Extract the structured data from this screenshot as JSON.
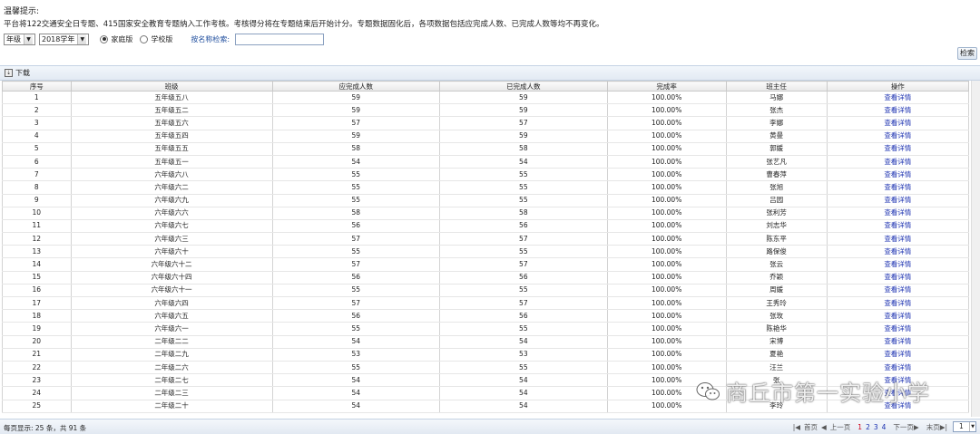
{
  "notice": {
    "title": "温馨提示:",
    "text": "平台将122交通安全日专题、415国家安全教育专题纳入工作考核。考核得分将在专题结束后开始计分。专题数据固化后，各项数据包括应完成人数、已完成人数等均不再变化。"
  },
  "filters": {
    "grade": "年级",
    "year": "2018学年",
    "radio_home": "家庭版",
    "radio_school": "学校版",
    "search_label": "按名称检索:",
    "search_value": "",
    "search_button": "检索"
  },
  "toolbar": {
    "download": "下载"
  },
  "table": {
    "headers": [
      "序号",
      "班级",
      "应完成人数",
      "已完成人数",
      "完成率",
      "班主任",
      "操作"
    ],
    "rows": [
      [
        "1",
        "五年级五八",
        "59",
        "59",
        "100.00%",
        "马娜",
        "查看详情"
      ],
      [
        "2",
        "五年级五二",
        "59",
        "59",
        "100.00%",
        "张杰",
        "查看详情"
      ],
      [
        "3",
        "五年级五六",
        "57",
        "57",
        "100.00%",
        "李娜",
        "查看详情"
      ],
      [
        "4",
        "五年级五四",
        "59",
        "59",
        "100.00%",
        "黄曼",
        "查看详情"
      ],
      [
        "5",
        "五年级五五",
        "58",
        "58",
        "100.00%",
        "郭媛",
        "查看详情"
      ],
      [
        "6",
        "五年级五一",
        "54",
        "54",
        "100.00%",
        "张艺凡",
        "查看详情"
      ],
      [
        "7",
        "六年级六八",
        "55",
        "55",
        "100.00%",
        "曹春萍",
        "查看详情"
      ],
      [
        "8",
        "六年级六二",
        "55",
        "55",
        "100.00%",
        "张旭",
        "查看详情"
      ],
      [
        "9",
        "六年级六九",
        "55",
        "55",
        "100.00%",
        "吕园",
        "查看详情"
      ],
      [
        "10",
        "六年级六六",
        "58",
        "58",
        "100.00%",
        "张利芳",
        "查看详情"
      ],
      [
        "11",
        "六年级六七",
        "56",
        "56",
        "100.00%",
        "刘志华",
        "查看详情"
      ],
      [
        "12",
        "六年级六三",
        "57",
        "57",
        "100.00%",
        "陈东平",
        "查看详情"
      ],
      [
        "13",
        "六年级六十",
        "55",
        "55",
        "100.00%",
        "路保俊",
        "查看详情"
      ],
      [
        "14",
        "六年级六十二",
        "57",
        "57",
        "100.00%",
        "张云",
        "查看详情"
      ],
      [
        "15",
        "六年级六十四",
        "56",
        "56",
        "100.00%",
        "乔颖",
        "查看详情"
      ],
      [
        "16",
        "六年级六十一",
        "55",
        "55",
        "100.00%",
        "周媛",
        "查看详情"
      ],
      [
        "17",
        "六年级六四",
        "57",
        "57",
        "100.00%",
        "王秀玲",
        "查看详情"
      ],
      [
        "18",
        "六年级六五",
        "56",
        "56",
        "100.00%",
        "张玫",
        "查看详情"
      ],
      [
        "19",
        "六年级六一",
        "55",
        "55",
        "100.00%",
        "陈艳华",
        "查看详情"
      ],
      [
        "20",
        "二年级二二",
        "54",
        "54",
        "100.00%",
        "宋博",
        "查看详情"
      ],
      [
        "21",
        "二年级二九",
        "53",
        "53",
        "100.00%",
        "夏艳",
        "查看详情"
      ],
      [
        "22",
        "二年级二六",
        "55",
        "55",
        "100.00%",
        "汪兰",
        "查看详情"
      ],
      [
        "23",
        "二年级二七",
        "54",
        "54",
        "100.00%",
        "张",
        "查看详情"
      ],
      [
        "24",
        "二年级二三",
        "54",
        "54",
        "100.00%",
        "",
        "查看详情"
      ],
      [
        "25",
        "二年级二十",
        "54",
        "54",
        "100.00%",
        "李玲",
        "查看详情"
      ]
    ]
  },
  "footer": {
    "info": "每页显示: 25 条，共 91 条",
    "first": "首页",
    "prev": "上一页",
    "pages": [
      "1",
      "2",
      "3",
      "4"
    ],
    "current_page": "1",
    "next": "下一页",
    "last": "末页",
    "page_select": "1"
  },
  "watermark": {
    "text": "商丘市第一实验小学"
  },
  "colors": {
    "link": "#1a2fb0",
    "current_page": "#d0021b",
    "toolbar_bg": "#e3eaf3"
  }
}
